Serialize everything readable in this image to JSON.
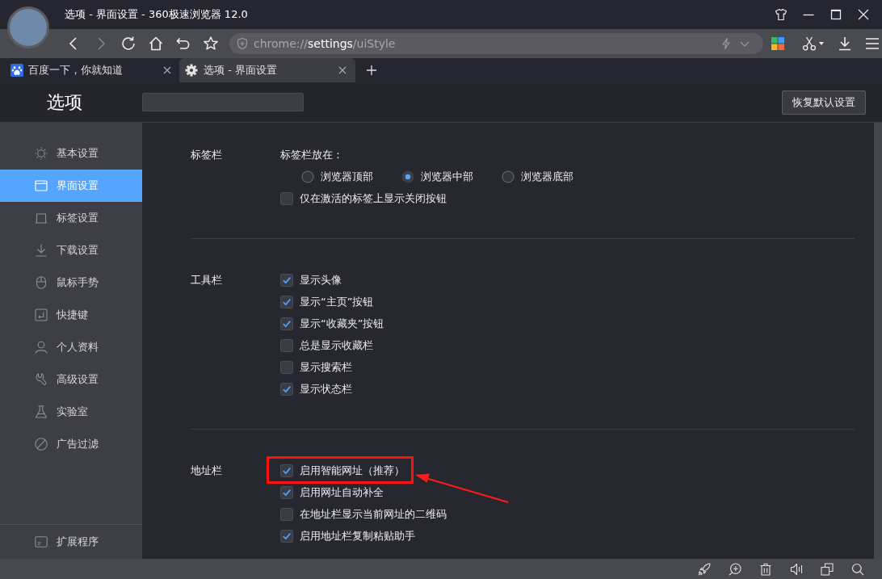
{
  "window": {
    "title": "选项 - 界面设置 - 360极速浏览器 12.0"
  },
  "toolbar": {
    "address": "chrome://**settings**/uiStyle"
  },
  "tabs": [
    {
      "title": "百度一下，你就知道",
      "selected": false
    },
    {
      "title": "选项 - 界面设置",
      "selected": true
    }
  ],
  "header": {
    "title": "选项",
    "reset_button": "恢复默认设置"
  },
  "sidebar": {
    "items": [
      {
        "label": "基本设置",
        "selected": false
      },
      {
        "label": "界面设置",
        "selected": true
      },
      {
        "label": "标签设置",
        "selected": false
      },
      {
        "label": "下载设置",
        "selected": false
      },
      {
        "label": "鼠标手势",
        "selected": false
      },
      {
        "label": "快捷键",
        "selected": false
      },
      {
        "label": "个人资料",
        "selected": false
      },
      {
        "label": "高级设置",
        "selected": false
      },
      {
        "label": "实验室",
        "selected": false
      },
      {
        "label": "广告过滤",
        "selected": false
      }
    ],
    "footer_item": "扩展程序"
  },
  "sections": [
    {
      "label": "标签栏",
      "prompt": "标签栏放在：",
      "radio_options": [
        {
          "label": "浏览器顶部",
          "selected": false
        },
        {
          "label": "浏览器中部",
          "selected": true
        },
        {
          "label": "浏览器底部",
          "selected": false
        }
      ],
      "checkboxes": [
        {
          "label": "仅在激活的标签上显示关闭按钮",
          "checked": false,
          "highlighted": false
        }
      ]
    },
    {
      "label": "工具栏",
      "checkboxes": [
        {
          "label": "显示头像",
          "checked": true,
          "highlighted": false
        },
        {
          "label": "显示“主页”按钮",
          "checked": true,
          "highlighted": false
        },
        {
          "label": "显示“收藏夹”按钮",
          "checked": true,
          "highlighted": false
        },
        {
          "label": "总是显示收藏栏",
          "checked": false,
          "highlighted": false
        },
        {
          "label": "显示搜索栏",
          "checked": false,
          "highlighted": false
        },
        {
          "label": "显示状态栏",
          "checked": true,
          "highlighted": false
        }
      ]
    },
    {
      "label": "地址栏",
      "checkboxes": [
        {
          "label": "启用智能网址（推荐）",
          "checked": true,
          "highlighted": true
        },
        {
          "label": "启用网址自动补全",
          "checked": true,
          "highlighted": false
        },
        {
          "label": "在地址栏显示当前网址的二维码",
          "checked": false,
          "highlighted": false
        },
        {
          "label": "启用地址栏复制粘贴助手",
          "checked": true,
          "highlighted": false
        }
      ]
    }
  ]
}
